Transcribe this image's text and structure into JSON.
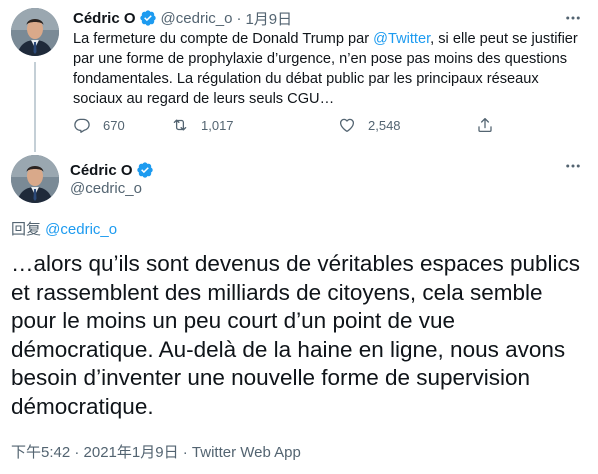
{
  "parent_tweet": {
    "author_name": "Cédric O",
    "handle": "@cedric_o",
    "separator": "·",
    "date": "1月9日",
    "text_before_link": "La fermeture du compte de Donald Trump par ",
    "link_text": "@Twitter",
    "text_after_link": ", si elle peut se justifier par une forme de prophylaxie d’urgence, n’en pose pas moins des questions fondamentales. La régulation du débat public par les principaux réseaux sociaux au regard de leurs seuls CGU…",
    "replies": "670",
    "retweets": "1,017",
    "likes": "2,548"
  },
  "main_tweet": {
    "author_name": "Cédric O",
    "handle": "@cedric_o",
    "replying_prefix": "回复 ",
    "replying_to": "@cedric_o",
    "text": "…alors qu’ils sont devenus de véritables espaces publics et rassemblent des milliards de citoyens, cela semble pour le moins un peu court d’un point de vue démocratique. Au-delà de la haine en ligne, nous avons besoin d’inventer une nouvelle forme de supervision démocratique.",
    "timestamp": "下午5:42 · 2021年1月9日 · Twitter Web App"
  },
  "icons": {
    "verified": "verified-badge-icon",
    "more": "more-options-icon",
    "reply": "reply-icon",
    "retweet": "retweet-icon",
    "like": "like-icon",
    "share": "share-icon"
  },
  "colors": {
    "link": "#1d9bf0",
    "secondary_text": "#536471",
    "primary_text": "#0f1419",
    "thread_line": "#c4cfd6"
  }
}
